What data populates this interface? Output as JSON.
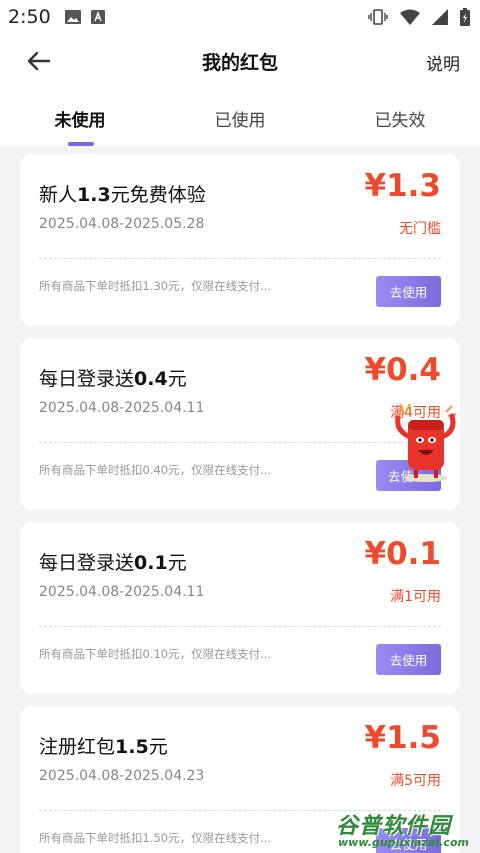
{
  "status_bar": {
    "time": "2:50"
  },
  "header": {
    "title": "我的红包",
    "action_label": "说明"
  },
  "tabs": [
    {
      "label": "未使用",
      "active": true
    },
    {
      "label": "已使用",
      "active": false
    },
    {
      "label": "已失效",
      "active": false
    }
  ],
  "cards": [
    {
      "title_prefix": "新人",
      "title_bold": "1.3",
      "title_suffix": "元免费体验",
      "date_range": "2025.04.08-2025.05.28",
      "amount": "¥1.3",
      "condition": "无门槛",
      "description": "所有商品下单时抵扣1.30元，仅限在线支付...",
      "button_label": "去使用"
    },
    {
      "title_prefix": "每日登录送",
      "title_bold": "0.4",
      "title_suffix": "元",
      "date_range": "2025.04.08-2025.04.11",
      "amount": "¥0.4",
      "condition": "满4可用",
      "description": "所有商品下单时抵扣0.40元，仅限在线支付...",
      "button_label": "去使"
    },
    {
      "title_prefix": "每日登录送",
      "title_bold": "0.1",
      "title_suffix": "元",
      "date_range": "2025.04.08-2025.04.11",
      "amount": "¥0.1",
      "condition": "满1可用",
      "description": "所有商品下单时抵扣0.10元，仅限在线支付...",
      "button_label": "去使用"
    },
    {
      "title_prefix": "注册红包",
      "title_bold": "1.5",
      "title_suffix": "元",
      "date_range": "2025.04.08-2025.04.23",
      "amount": "¥1.5",
      "condition": "满5可用",
      "description": "所有商品下单时抵扣1.50元，仅限在线支付...",
      "button_label": "去使用"
    }
  ],
  "watermark": {
    "title": "谷普软件园",
    "url": "www.gupuxiazai.com"
  },
  "colors": {
    "accent": "#7a68e8",
    "price": "#ee4a2e",
    "button_start": "#9b8cf2",
    "button_end": "#7b6ae0"
  }
}
